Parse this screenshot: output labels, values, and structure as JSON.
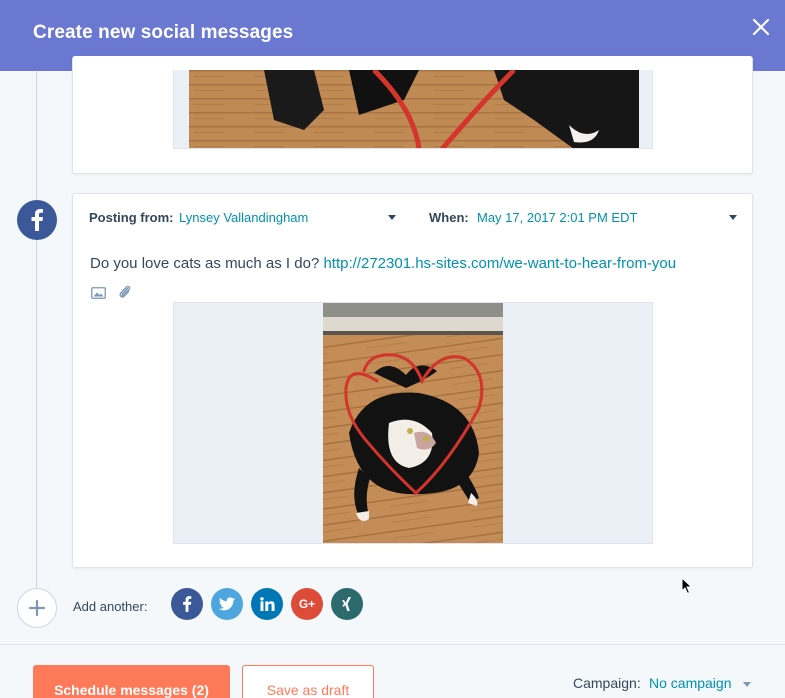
{
  "header": {
    "title": "Create new social messages",
    "close_icon": "close-icon"
  },
  "post": {
    "network_icon": "facebook-icon",
    "posting_from_label": "Posting from:",
    "posting_from_value": "Lynsey Vallandingham",
    "when_label": "When:",
    "when_value": "May 17, 2017 2:01 PM EDT",
    "message_text": "Do you love cats as much as I do?",
    "message_link": "http://272301.hs-sites.com/we-want-to-hear-from-you",
    "attach_icons": [
      "image-icon",
      "paperclip-icon"
    ]
  },
  "add_another": {
    "label": "Add another:",
    "networks": [
      {
        "name": "facebook",
        "glyph": "f",
        "color": "#3b5998"
      },
      {
        "name": "twitter",
        "glyph": "t",
        "color": "#4da7de"
      },
      {
        "name": "linkedin",
        "glyph": "in",
        "color": "#0077b5"
      },
      {
        "name": "google-plus",
        "glyph": "G+",
        "color": "#dd4b39"
      },
      {
        "name": "xing",
        "glyph": "x",
        "color": "#2d6a6e"
      }
    ]
  },
  "footer": {
    "schedule_label": "Schedule messages (2)",
    "draft_label": "Save as draft",
    "campaign_label": "Campaign:",
    "campaign_value": "No campaign"
  },
  "colors": {
    "header_bg": "#6a78d1",
    "accent_orange": "#ff7a59",
    "link_teal": "#0091ae",
    "facebook_blue": "#3b5998"
  }
}
